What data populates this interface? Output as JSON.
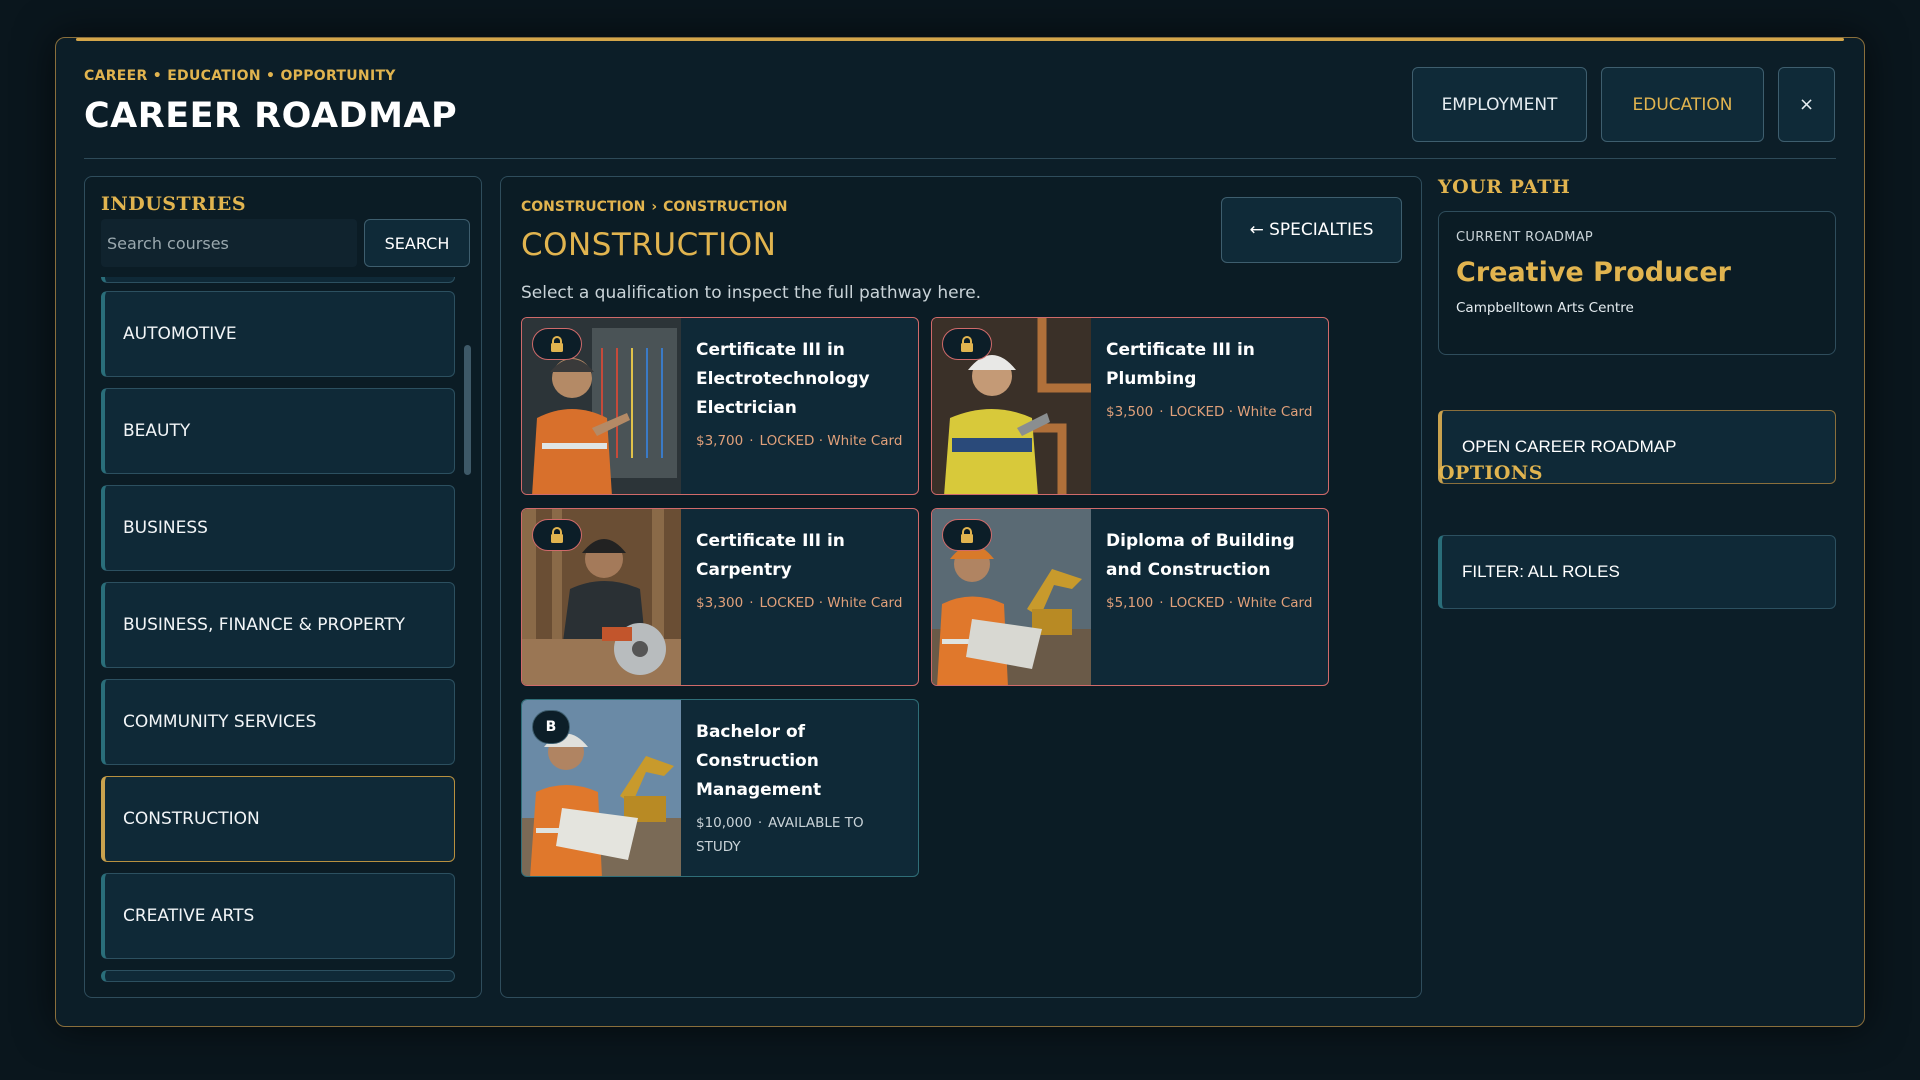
{
  "header": {
    "eyebrow": "CAREER • EDUCATION • OPPORTUNITY",
    "title": "CAREER ROADMAP",
    "employment_label": "EMPLOYMENT",
    "education_label": "EDUCATION",
    "close_label": "×"
  },
  "industries": {
    "heading": "INDUSTRIES",
    "search_placeholder": "Search courses",
    "search_label": "SEARCH",
    "items": [
      {
        "label": "AUTOMOTIVE",
        "active": false
      },
      {
        "label": "BEAUTY",
        "active": false
      },
      {
        "label": "BUSINESS",
        "active": false
      },
      {
        "label": "BUSINESS, FINANCE & PROPERTY",
        "active": false
      },
      {
        "label": "COMMUNITY SERVICES",
        "active": false
      },
      {
        "label": "CONSTRUCTION",
        "active": true
      },
      {
        "label": "CREATIVE ARTS",
        "active": false
      }
    ]
  },
  "main": {
    "breadcrumb": [
      "CONSTRUCTION",
      "CONSTRUCTION"
    ],
    "breadcrumb_sep": "›",
    "title": "CONSTRUCTION",
    "back_label": "← SPECIALTIES",
    "hint": "Select a qualification to inspect the full pathway here.",
    "courses": [
      {
        "title": "Certificate III in Electrotechnology Electrician",
        "price": "$3,700",
        "status": "LOCKED",
        "requirement": "White Card",
        "badge": "lock"
      },
      {
        "title": "Certificate III in Plumbing",
        "price": "$3,500",
        "status": "LOCKED",
        "requirement": "White Card",
        "badge": "lock"
      },
      {
        "title": "Certificate III in Carpentry",
        "price": "$3,300",
        "status": "LOCKED",
        "requirement": "White Card",
        "badge": "lock"
      },
      {
        "title": "Diploma of Building and Construction",
        "price": "$5,100",
        "status": "LOCKED",
        "requirement": "White Card",
        "badge": "lock"
      },
      {
        "title": "Bachelor of Construction Management",
        "price": "$10,000",
        "status": "AVAILABLE TO STUDY",
        "requirement": "",
        "badge": "B"
      }
    ]
  },
  "path": {
    "heading": "YOUR PATH",
    "current_label": "CURRENT ROADMAP",
    "role": "Creative Producer",
    "organisation": "Campbelltown Arts Centre",
    "open_label": "OPEN CAREER ROADMAP"
  },
  "options": {
    "heading": "OPTIONS",
    "filter_label": "FILTER: ALL ROLES"
  },
  "colors": {
    "accent_gold": "#e1b44f",
    "locked_border": "#d06a6a",
    "panel_bg": "#0b1c25",
    "window_bg": "#0c1e28"
  }
}
